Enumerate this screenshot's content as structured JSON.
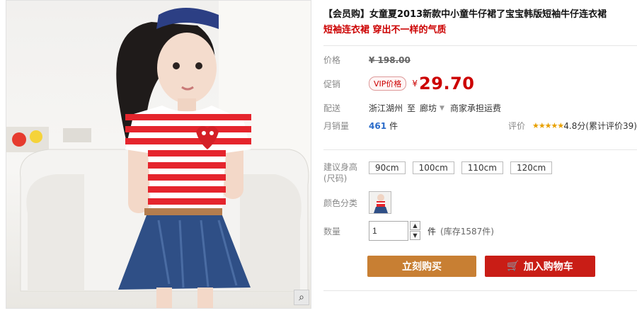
{
  "product": {
    "title": "【会员购】女童夏2013新款中小童牛仔裙了宝宝韩版短袖牛仔连衣裙",
    "subtitle": "短袖连衣裙 穿出不一样的气质"
  },
  "price": {
    "label": "价格",
    "original": "¥ 198.00"
  },
  "promo": {
    "label": "促销",
    "badge": "VIP价格",
    "currency": "¥",
    "amount": "29.70"
  },
  "shipping": {
    "label": "配送",
    "from": "浙江湖州",
    "to_word": "至",
    "destination": "廊坊",
    "note": "商家承担运费"
  },
  "sales": {
    "label": "月销量",
    "count": "461",
    "unit": "件",
    "review_label": "评价",
    "rating": "4.8分",
    "review_count": "(累计评价39)"
  },
  "size": {
    "label": "建议身高(尺码)",
    "options": [
      "90cm",
      "100cm",
      "110cm",
      "120cm"
    ]
  },
  "color": {
    "label": "颜色分类"
  },
  "quantity": {
    "label": "数量",
    "value": "1",
    "unit": "件",
    "stock": "(库存1587件)",
    "up": "▲",
    "down": "▼"
  },
  "actions": {
    "buy_now": "立刻购买",
    "add_to_cart": "加入购物车"
  },
  "colors": {
    "price_red": "#c00000",
    "buy_button": "#c87f33",
    "cart_button": "#c91d16"
  }
}
